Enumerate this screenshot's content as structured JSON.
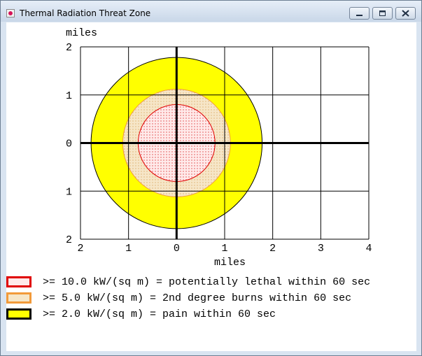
{
  "window": {
    "title": "Thermal Radiation Threat Zone",
    "controls": [
      "minimize",
      "maximize",
      "close"
    ]
  },
  "chart_data": {
    "type": "threat-zone",
    "y_axis_label": "miles",
    "x_axis_label": "miles",
    "x_ticks": [
      {
        "value": -2,
        "label": "2"
      },
      {
        "value": -1,
        "label": "1"
      },
      {
        "value": 0,
        "label": "0"
      },
      {
        "value": 1,
        "label": "1"
      },
      {
        "value": 2,
        "label": "2"
      },
      {
        "value": 3,
        "label": "3"
      },
      {
        "value": 4,
        "label": "4"
      }
    ],
    "y_ticks": [
      {
        "value": 2,
        "label": "2"
      },
      {
        "value": 1,
        "label": "1"
      },
      {
        "value": 0,
        "label": "0"
      },
      {
        "value": -1,
        "label": "1"
      },
      {
        "value": -2,
        "label": "2"
      }
    ],
    "xlim": [
      -2,
      4
    ],
    "ylim": [
      -2,
      2
    ],
    "grid": true,
    "zones": [
      {
        "name": "pain",
        "radius_miles": 1.78,
        "fill": "#ffff00",
        "stroke": "#000000",
        "pattern": "solid"
      },
      {
        "name": "2nd degree burns",
        "radius_miles": 1.12,
        "fill": "#f6e6c8",
        "stroke": "#f29a3a",
        "pattern": "dots-orange"
      },
      {
        "name": "potentially lethal",
        "radius_miles": 0.8,
        "fill": "#ffeaea",
        "stroke": "#e00000",
        "pattern": "dots-red"
      }
    ]
  },
  "legend": [
    {
      "text": ">= 10.0 kW/(sq m) = potentially lethal within 60 sec",
      "border": "#e00000",
      "fill": "#ffeaea"
    },
    {
      "text": ">= 5.0 kW/(sq m) = 2nd degree burns within 60 sec",
      "border": "#f29a3a",
      "fill": "#f6e6c8"
    },
    {
      "text": ">= 2.0 kW/(sq m) = pain within 60 sec",
      "border": "#000000",
      "fill": "#ffff00"
    }
  ]
}
